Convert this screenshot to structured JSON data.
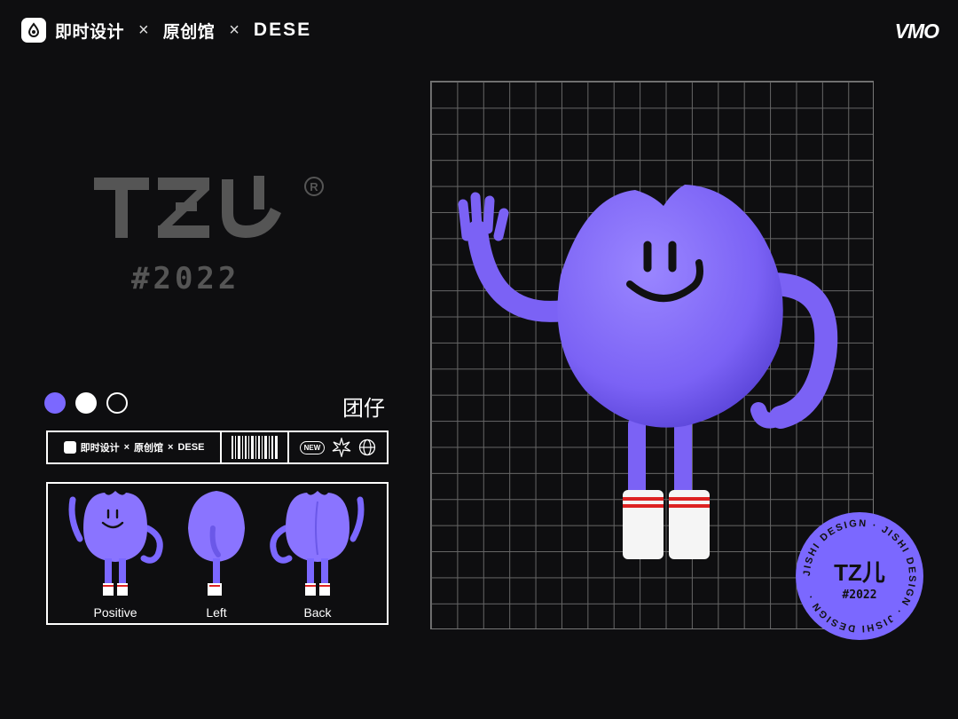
{
  "header": {
    "brand1": "即时设计",
    "sep1": "×",
    "brand2": "原创馆",
    "sep2": "×",
    "brand3": "DESE",
    "right_logo": "VMO"
  },
  "mark": {
    "text": "TZ儿",
    "registered": "®",
    "year": "#2022"
  },
  "character": {
    "name": "团仔"
  },
  "colors": {
    "purple": "#7b68ff",
    "white": "#ffffff",
    "outline": "#ffffff",
    "bg": "#0e0e10"
  },
  "strip": {
    "brand1": "即时设计",
    "sep1": "×",
    "brand2": "原创馆",
    "sep2": "×",
    "brand3": "DESE",
    "badge_new": "NEW",
    "icons": [
      "barcode-icon",
      "burst-icon",
      "globe-icon"
    ]
  },
  "views": [
    {
      "label": "Positive"
    },
    {
      "label": "Left"
    },
    {
      "label": "Back"
    }
  ],
  "badge": {
    "ring_text": "JISHI DESIGN",
    "center": "TZ儿",
    "year": "#2022"
  }
}
